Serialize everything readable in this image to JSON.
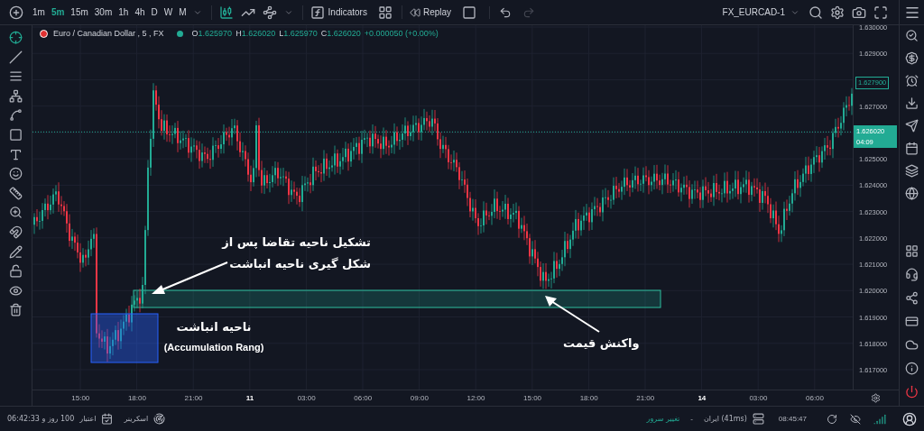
{
  "toolbar": {
    "timeframes": [
      {
        "label": "1m",
        "selected": false
      },
      {
        "label": "5m",
        "selected": true
      },
      {
        "label": "15m",
        "selected": false
      },
      {
        "label": "30m",
        "selected": false
      },
      {
        "label": "1h",
        "selected": false
      },
      {
        "label": "4h",
        "selected": false
      },
      {
        "label": "D",
        "selected": false
      },
      {
        "label": "W",
        "selected": false
      },
      {
        "label": "M",
        "selected": false
      }
    ],
    "indicators_label": "Indicators",
    "replay_label": "Replay",
    "history": [
      {
        "kind": "undo",
        "disabled": false
      },
      {
        "kind": "redo",
        "disabled": true
      }
    ],
    "symbol": "FX_EURCAD-1"
  },
  "legend": {
    "title": "Euro / Canadian Dollar , 5 , FX",
    "ohlc": [
      {
        "label": "O",
        "value": "1.625970"
      },
      {
        "label": "H",
        "value": "1.626020"
      },
      {
        "label": "L",
        "value": "1.625970"
      },
      {
        "label": "C",
        "value": "1.626020"
      }
    ],
    "change": "+0.000050 (+0.00%)"
  },
  "price_axis": {
    "labels": [
      "1.630000",
      "1.629000",
      "1.627000",
      "1.625000",
      "1.624000",
      "1.623000",
      "1.622000",
      "1.621000",
      "1.620000",
      "1.619000",
      "1.618000",
      "1.617000"
    ],
    "marked_price": "1.627900",
    "last_price": "1.626020",
    "countdown": "04:09"
  },
  "time_axis": [
    {
      "label": "15:00",
      "kind": "time"
    },
    {
      "label": "18:00",
      "kind": "time"
    },
    {
      "label": "21:00",
      "kind": "time"
    },
    {
      "label": "11",
      "kind": "day"
    },
    {
      "label": "03:00",
      "kind": "time"
    },
    {
      "label": "06:00",
      "kind": "time"
    },
    {
      "label": "09:00",
      "kind": "time"
    },
    {
      "label": "12:00",
      "kind": "time"
    },
    {
      "label": "15:00",
      "kind": "time"
    },
    {
      "label": "18:00",
      "kind": "time"
    },
    {
      "label": "21:00",
      "kind": "time"
    },
    {
      "label": "14",
      "kind": "day"
    },
    {
      "label": "03:00",
      "kind": "time"
    },
    {
      "label": "06:00",
      "kind": "time"
    }
  ],
  "annotations": {
    "demand": "تشکیل ناحیه تقاضا پس از\nشکل گیری ناحیه انباشت",
    "accumulation": "ناحیه انباشت",
    "accumulation_en": "(Accumulation Rang)",
    "reaction": "واکنش قیمت"
  },
  "status_bar": {
    "credit_time": "100 روز و 06:42:33",
    "credit_label": "اعتبار",
    "screener_label": "اسکرینر",
    "server_change": "تغییر سرور",
    "separator": "-",
    "server": "ایران (41ms)",
    "clock": "08:45:47"
  }
}
